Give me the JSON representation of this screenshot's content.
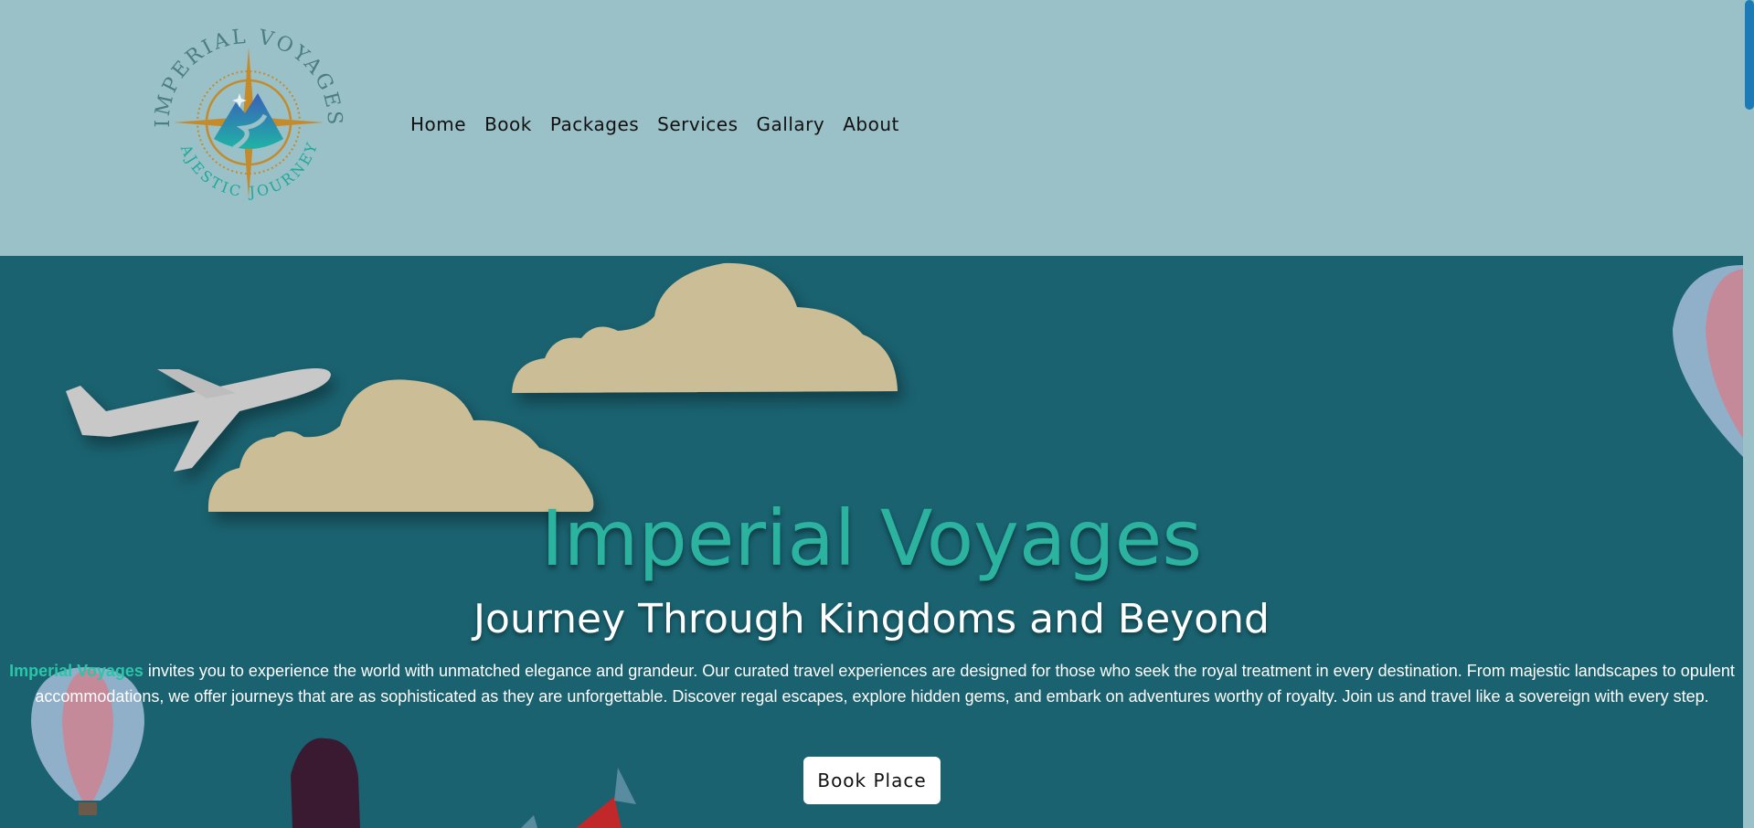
{
  "logo": {
    "top_text": "IMPERIAL VOYAGES",
    "bottom_text": "MAJESTIC JOURNEYS",
    "icon": "compass-mountain-icon"
  },
  "nav": {
    "items": [
      {
        "label": "Home"
      },
      {
        "label": "Book"
      },
      {
        "label": "Packages"
      },
      {
        "label": "Services"
      },
      {
        "label": "Gallary"
      },
      {
        "label": "About"
      }
    ]
  },
  "hero": {
    "title": "Imperial Voyages",
    "subtitle": "Journey Through Kingdoms and Beyond",
    "desc_brand": "Imperial Voyages",
    "desc_rest": " invites you to experience the world with unmatched elegance and grandeur. Our curated travel experiences are designed for those who seek the royal treatment in every destination. From majestic landscapes to opulent accommodations, we offer journeys that are as sophisticated as they are unforgettable. Discover regal escapes, explore hidden gems, and embark on adventures worthy of royalty. Join us and travel like a sovereign with every step.",
    "button_label": "Book Place"
  },
  "colors": {
    "header_bg": "#9ac0c8",
    "hero_bg": "#1a6270",
    "accent": "#2bb3a0",
    "scroll_thumb": "#1b7bb6"
  }
}
